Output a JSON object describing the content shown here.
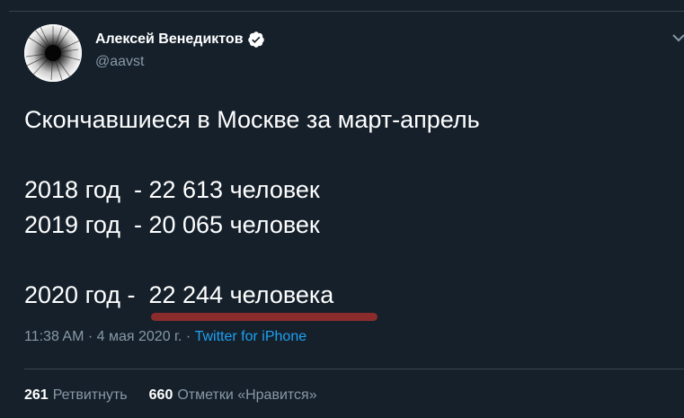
{
  "author": {
    "display_name": "Алексей Венедиктов",
    "handle": "@aavst",
    "verified": true,
    "avatar_icon": "avatar-image"
  },
  "tweet": {
    "lines": [
      "Скончавшиеся в Москве за март-апрель",
      "",
      "2018 год  - 22 613 человек",
      "2019 год  - 20 065 человек",
      "",
      "2020 год -  22 244 человека"
    ],
    "highlight_color": "#8b2c2c"
  },
  "meta": {
    "time": "11:38 AM",
    "separator": "·",
    "date": "4 мая 2020 г.",
    "source": "Twitter for iPhone"
  },
  "stats": {
    "retweets_count": "261",
    "retweets_label": "Ретвитнуть",
    "likes_count": "660",
    "likes_label": "Отметки «Нравится»"
  },
  "colors": {
    "background": "#15202b",
    "text": "#ffffff",
    "secondary": "#8899a6",
    "link": "#1da1f2",
    "border": "#38444d"
  }
}
